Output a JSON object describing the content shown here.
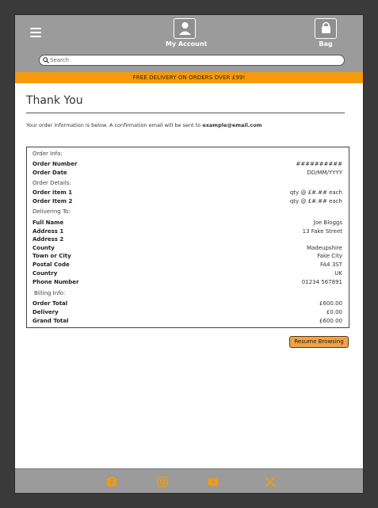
{
  "header": {
    "account_label": "My Account",
    "bag_label": "Bag"
  },
  "search": {
    "placeholder": "Search",
    "value": ""
  },
  "promo": {
    "text": "FREE DELIVERY ON ORDERS OVER £99!"
  },
  "page": {
    "title": "Thank You",
    "intro_text": "Your order information is below. A confirmation email will be sent to ",
    "intro_email": "example@email.com"
  },
  "order": {
    "info_heading": "Order Info:",
    "number_label": "Order Number",
    "number_value": "##########",
    "date_label": "Order Date",
    "date_value": "DD/MM/YYYY",
    "details_heading": "Order Details:",
    "items": [
      {
        "label": "Order item 1",
        "value": "qty @ £#.## each"
      },
      {
        "label": "Order Item 2",
        "value": "qty @ £#.## each"
      }
    ],
    "delivery_heading": "Delivering To:",
    "delivery": [
      {
        "label": "Full Name",
        "value": "Joe Bloggs"
      },
      {
        "label": "Address 1",
        "value": "13 Fake Street"
      },
      {
        "label": "Address 2",
        "value": ""
      },
      {
        "label": "County",
        "value": "Madeupshire"
      },
      {
        "label": "Town or City",
        "value": "Fake City"
      },
      {
        "label": "Postal Code",
        "value": "FA4 3ST"
      },
      {
        "label": "Country",
        "value": "UK"
      },
      {
        "label": "Phone Number",
        "value": "01234 567891"
      }
    ],
    "billing_heading": "Billing Info:",
    "billing": [
      {
        "label": "Order Total",
        "value": "£600.00"
      },
      {
        "label": "Delivery",
        "value": "£0.00"
      },
      {
        "label": "Grand Total",
        "value": "£600.00"
      }
    ]
  },
  "actions": {
    "resume_label": "Resume Browsing"
  },
  "footer": {
    "icons": [
      "facebook-icon",
      "instagram-icon",
      "youtube-icon",
      "x-icon"
    ],
    "icon_color": "#f59a0c"
  },
  "colors": {
    "accent": "#f59a0c",
    "header_bg": "#9b9b9b",
    "button_bg": "#f0a24a"
  }
}
